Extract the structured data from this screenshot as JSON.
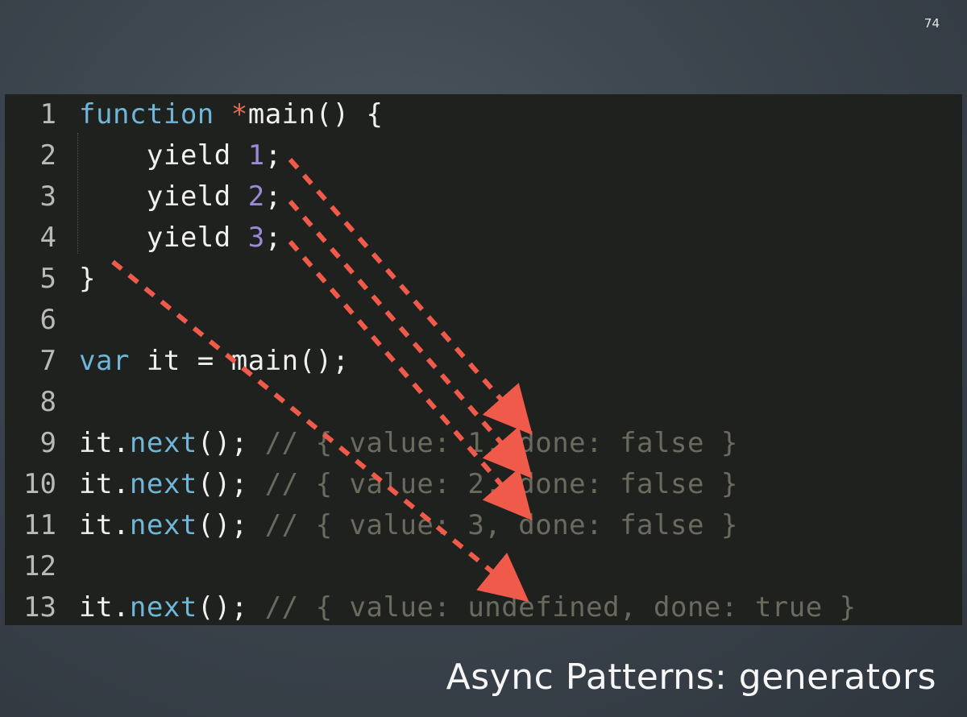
{
  "slide": {
    "page_number": "74",
    "title": "Async Patterns: generators"
  },
  "code": {
    "lines": [
      {
        "num": "1",
        "parts": [
          {
            "t": "function",
            "c": "kw"
          },
          {
            "t": " ",
            "c": ""
          },
          {
            "t": "*",
            "c": "star"
          },
          {
            "t": "main() {",
            "c": ""
          }
        ]
      },
      {
        "num": "2",
        "parts": [
          {
            "t": "    yield ",
            "c": ""
          },
          {
            "t": "1",
            "c": "num"
          },
          {
            "t": ";",
            "c": ""
          }
        ]
      },
      {
        "num": "3",
        "parts": [
          {
            "t": "    yield ",
            "c": ""
          },
          {
            "t": "2",
            "c": "num"
          },
          {
            "t": ";",
            "c": ""
          }
        ]
      },
      {
        "num": "4",
        "parts": [
          {
            "t": "    yield ",
            "c": ""
          },
          {
            "t": "3",
            "c": "num"
          },
          {
            "t": ";",
            "c": ""
          }
        ]
      },
      {
        "num": "5",
        "parts": [
          {
            "t": "}",
            "c": ""
          }
        ]
      },
      {
        "num": "6",
        "parts": []
      },
      {
        "num": "7",
        "parts": [
          {
            "t": "var",
            "c": "kw"
          },
          {
            "t": " it = main();",
            "c": ""
          }
        ]
      },
      {
        "num": "8",
        "parts": []
      },
      {
        "num": "9",
        "parts": [
          {
            "t": "it.",
            "c": ""
          },
          {
            "t": "next",
            "c": "fn"
          },
          {
            "t": "(); ",
            "c": ""
          },
          {
            "t": "// { value: 1, done: false }",
            "c": "cm"
          }
        ]
      },
      {
        "num": "10",
        "parts": [
          {
            "t": "it.",
            "c": ""
          },
          {
            "t": "next",
            "c": "fn"
          },
          {
            "t": "(); ",
            "c": ""
          },
          {
            "t": "// { value: 2, done: false }",
            "c": "cm"
          }
        ]
      },
      {
        "num": "11",
        "parts": [
          {
            "t": "it.",
            "c": ""
          },
          {
            "t": "next",
            "c": "fn"
          },
          {
            "t": "(); ",
            "c": ""
          },
          {
            "t": "// { value: 3, done: false }",
            "c": "cm"
          }
        ]
      },
      {
        "num": "12",
        "parts": []
      },
      {
        "num": "13",
        "parts": [
          {
            "t": "it.",
            "c": ""
          },
          {
            "t": "next",
            "c": "fn"
          },
          {
            "t": "(); ",
            "c": ""
          },
          {
            "t": "// { value: undefined, done: true }",
            "c": "cm"
          }
        ]
      }
    ]
  },
  "colors": {
    "arrow": "#ef5a4a",
    "keyword": "#6fb6d8",
    "number": "#9b8bd6",
    "comment": "#6a6a5e",
    "panel_background": "#1f211e"
  },
  "annotations": {
    "arrow_count": 4,
    "arrow_style": "dashed red arrows linking each yield to its it.next() result"
  }
}
